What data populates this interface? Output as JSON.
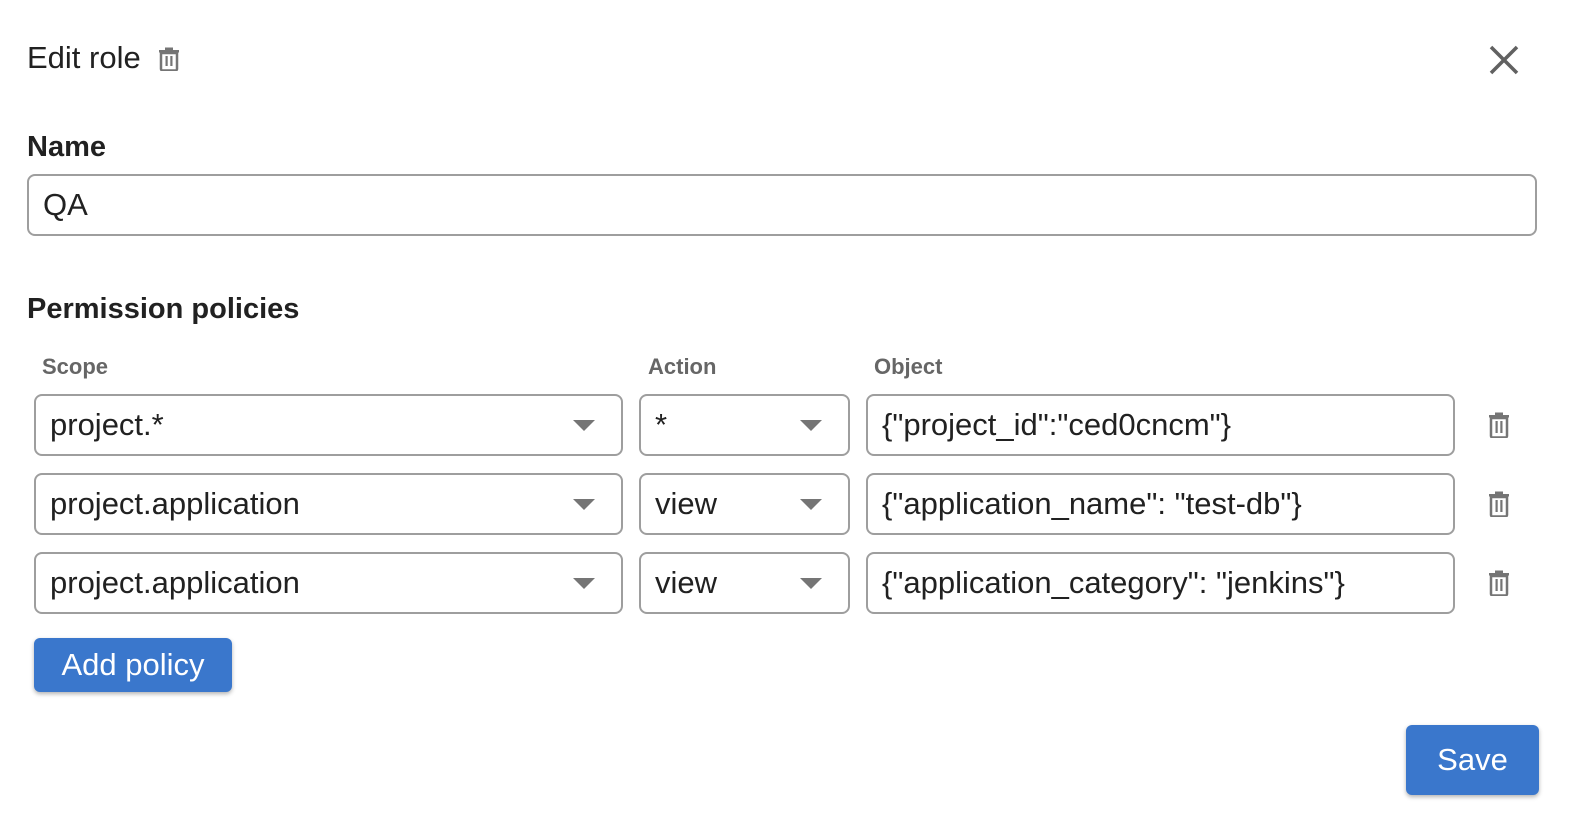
{
  "dialog": {
    "title": "Edit role",
    "close_label": "Close"
  },
  "name_field": {
    "label": "Name",
    "value": "QA"
  },
  "permissions": {
    "section_label": "Permission policies",
    "columns": {
      "scope": "Scope",
      "action": "Action",
      "object": "Object"
    },
    "policies": [
      {
        "scope": "project.*",
        "action": "*",
        "object": "{\"project_id\":\"ced0cncm\"}"
      },
      {
        "scope": "project.application",
        "action": "view",
        "object": "{\"application_name\": \"test-db\"}"
      },
      {
        "scope": "project.application",
        "action": "view",
        "object": "{\"application_category\": \"jenkins\"}"
      }
    ],
    "add_label": "Add policy"
  },
  "footer": {
    "save_label": "Save"
  },
  "colors": {
    "primary": "#3a77cc",
    "border": "#9e9e9e",
    "icon": "#757575"
  }
}
